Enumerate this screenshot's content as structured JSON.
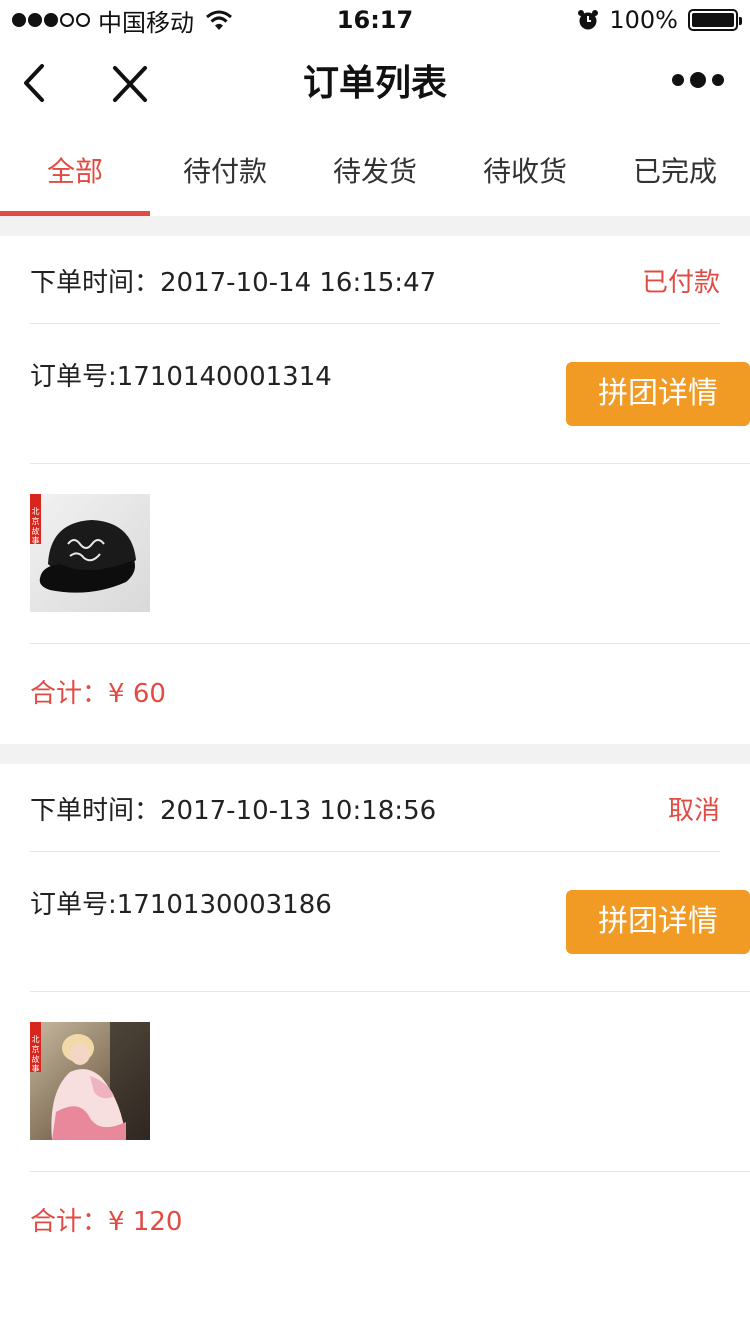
{
  "status_bar": {
    "carrier": "中国移动",
    "time": "16:17",
    "battery": "100%"
  },
  "nav": {
    "title": "订单列表"
  },
  "tabs": [
    {
      "label": "全部",
      "active": true
    },
    {
      "label": "待付款",
      "active": false
    },
    {
      "label": "待发货",
      "active": false
    },
    {
      "label": "待收货",
      "active": false
    },
    {
      "label": "已完成",
      "active": false
    }
  ],
  "orders": [
    {
      "time_label": "下单时间：",
      "time": "2017-10-14 16:15:47",
      "status": "已付款",
      "order_no_label": "订单号:",
      "order_no": "1710140001314",
      "button": "拼团详情",
      "product_image": "black-baseball-cap",
      "total_label": "合计：",
      "total": "¥ 60"
    },
    {
      "time_label": "下单时间：",
      "time": "2017-10-13 10:18:56",
      "status": "取消",
      "order_no_label": "订单号:",
      "order_no": "1710130003186",
      "button": "拼团详情",
      "product_image": "woman-pink-dress",
      "total_label": "合计：",
      "total": "¥ 120"
    }
  ],
  "colors": {
    "accent": "#e14b43",
    "button": "#f29b24",
    "separator": "#f2f2f2"
  }
}
